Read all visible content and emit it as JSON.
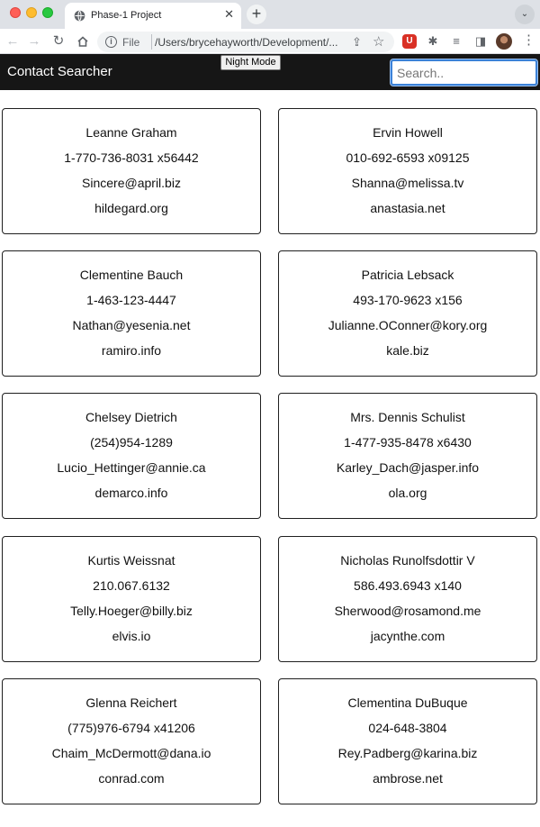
{
  "browser": {
    "tab_title": "Phase-1 Project",
    "tab_close": "✕",
    "new_tab": "+",
    "scheme_label": "File",
    "url": "/Users/brycehayworth/Development/...",
    "icons": {
      "favicon": "globe-icon",
      "back": "arrow-left-icon",
      "forward": "arrow-right-icon",
      "reload": "reload-icon",
      "home": "home-icon",
      "info": "info-icon",
      "share": "share-icon",
      "bookmark": "star-icon",
      "extension_1": "ublock-icon",
      "extension_2": "puzzle-icon",
      "media": "media-control-icon",
      "side_panel": "side-panel-icon",
      "profile": "avatar",
      "menu": "kebab-menu-icon"
    }
  },
  "app": {
    "title": "Contact Searcher",
    "night_mode_label": "Night Mode",
    "search_placeholder": "Search..",
    "header_color": "#161616"
  },
  "contacts": [
    {
      "name": "Leanne Graham",
      "phone": "1-770-736-8031 x56442",
      "email": "Sincere@april.biz",
      "website": "hildegard.org"
    },
    {
      "name": "Ervin Howell",
      "phone": "010-692-6593 x09125",
      "email": "Shanna@melissa.tv",
      "website": "anastasia.net"
    },
    {
      "name": "Clementine Bauch",
      "phone": "1-463-123-4447",
      "email": "Nathan@yesenia.net",
      "website": "ramiro.info"
    },
    {
      "name": "Patricia Lebsack",
      "phone": "493-170-9623 x156",
      "email": "Julianne.OConner@kory.org",
      "website": "kale.biz"
    },
    {
      "name": "Chelsey Dietrich",
      "phone": "(254)954-1289",
      "email": "Lucio_Hettinger@annie.ca",
      "website": "demarco.info"
    },
    {
      "name": "Mrs. Dennis Schulist",
      "phone": "1-477-935-8478 x6430",
      "email": "Karley_Dach@jasper.info",
      "website": "ola.org"
    },
    {
      "name": "Kurtis Weissnat",
      "phone": "210.067.6132",
      "email": "Telly.Hoeger@billy.biz",
      "website": "elvis.io"
    },
    {
      "name": "Nicholas Runolfsdottir V",
      "phone": "586.493.6943 x140",
      "email": "Sherwood@rosamond.me",
      "website": "jacynthe.com"
    },
    {
      "name": "Glenna Reichert",
      "phone": "(775)976-6794 x41206",
      "email": "Chaim_McDermott@dana.io",
      "website": "conrad.com"
    },
    {
      "name": "Clementina DuBuque",
      "phone": "024-648-3804",
      "email": "Rey.Padberg@karina.biz",
      "website": "ambrose.net"
    }
  ]
}
